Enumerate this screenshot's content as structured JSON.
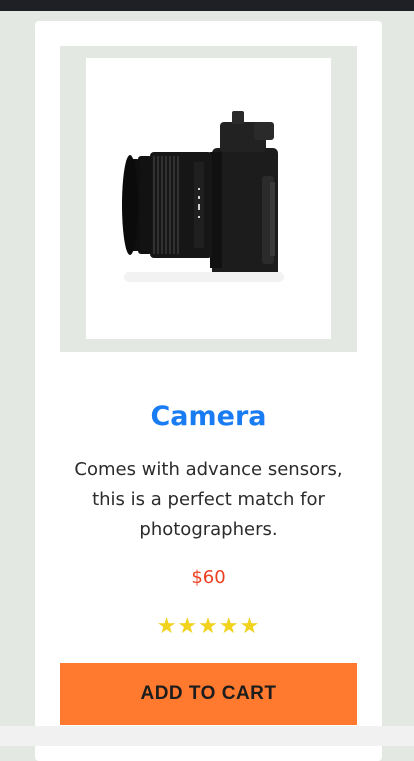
{
  "product": {
    "title": "Camera",
    "description": "Comes with advance sensors, this is a perfect match for photographers.",
    "price": "$60",
    "rating": 5,
    "rating_max": 5,
    "stars": "★★★★★",
    "image_icon": "camera-photo",
    "cart_label": "ADD TO CART"
  },
  "colors": {
    "accent": "#1a7cf2",
    "price": "#ee3f22",
    "star": "#f1d21d",
    "button": "#ff7a2e",
    "page_bg": "#e3e8e2"
  }
}
